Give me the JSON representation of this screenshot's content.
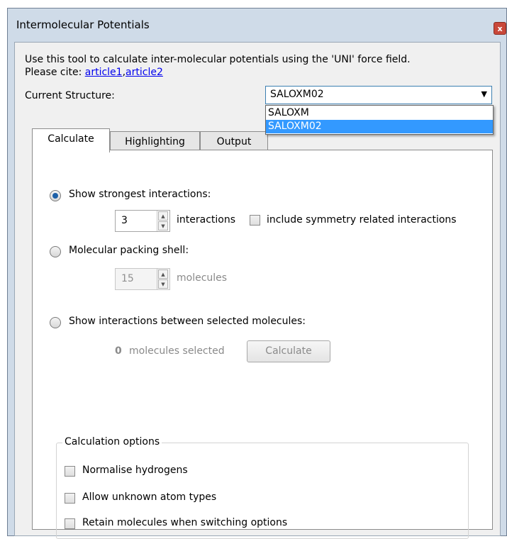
{
  "window": {
    "title": "Intermolecular Potentials",
    "close_glyph": "x"
  },
  "intro": {
    "line1": "Use this tool to calculate inter-molecular potentials using the 'UNI' force field.",
    "cite_prefix": "Please cite: ",
    "link1": "article1",
    "separator": ",",
    "link2": "article2"
  },
  "structure": {
    "label": "Current Structure:",
    "selected": "SALOXM02",
    "options": [
      "SALOXM",
      "SALOXM02"
    ],
    "highlighted_option": "SALOXM02"
  },
  "tabs": [
    {
      "label": "Calculate",
      "active": true
    },
    {
      "label": "Highlighting"
    },
    {
      "label": "Output"
    }
  ],
  "strongest": {
    "label": "Show strongest interactions:",
    "value": "3",
    "unit": "interactions",
    "symmetry_label": "include symmetry related interactions",
    "selected": true
  },
  "packing": {
    "label": "Molecular packing shell:",
    "value": "15",
    "unit": "molecules",
    "selected": false
  },
  "selected_mols": {
    "label": "Show interactions between selected molecules:",
    "count": "0",
    "text": "molecules selected",
    "button": "Calculate",
    "selected": false
  },
  "options": {
    "legend": "Calculation options",
    "items": [
      "Normalise hydrogens",
      "Allow unknown atom types",
      "Retain molecules when switching options"
    ]
  },
  "colors": {
    "accent": "#3399ff",
    "radio_fill": "#1d5fa7",
    "link": "#0000ee"
  }
}
